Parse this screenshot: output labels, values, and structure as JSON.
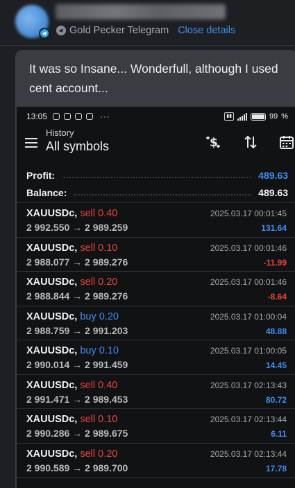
{
  "review": {
    "source": "Gold Pecker Telegram",
    "close_link": "Close details",
    "text": "It was so Insane... Wonderfull, although I used cent account..."
  },
  "phone": {
    "status": {
      "time": "13:05",
      "dots": "···",
      "battery": "99"
    },
    "app_bar": {
      "subtitle": "History",
      "title": "All symbols"
    },
    "summary": {
      "profit_label": "Profit:",
      "profit_value": "489.63",
      "balance_label": "Balance:",
      "balance_value": "489.63"
    },
    "trades": [
      {
        "symbol": "XAUUSDc,",
        "side": "sell",
        "side_text": "sell 0.40",
        "prices": "2 992.550 → 2 989.259",
        "date": "2025.03.17 00:01:45",
        "profit": "131.64",
        "sign": "pos"
      },
      {
        "symbol": "XAUUSDc,",
        "side": "sell",
        "side_text": "sell 0.10",
        "prices": "2 988.077 → 2 989.276",
        "date": "2025.03.17 00:01:46",
        "profit": "-11.99",
        "sign": "neg"
      },
      {
        "symbol": "XAUUSDc,",
        "side": "sell",
        "side_text": "sell 0.20",
        "prices": "2 988.844 → 2 989.276",
        "date": "2025.03.17 00:01:46",
        "profit": "-8.64",
        "sign": "neg"
      },
      {
        "symbol": "XAUUSDc,",
        "side": "buy",
        "side_text": "buy 0.20",
        "prices": "2 988.759 → 2 991.203",
        "date": "2025.03.17 01:00:04",
        "profit": "48.88",
        "sign": "pos"
      },
      {
        "symbol": "XAUUSDc,",
        "side": "buy",
        "side_text": "buy 0.10",
        "prices": "2 990.014 → 2 991.459",
        "date": "2025.03.17 01:00:05",
        "profit": "14.45",
        "sign": "pos"
      },
      {
        "symbol": "XAUUSDc,",
        "side": "sell",
        "side_text": "sell 0.40",
        "prices": "2 991.471 → 2 989.453",
        "date": "2025.03.17 02:13:43",
        "profit": "80.72",
        "sign": "pos"
      },
      {
        "symbol": "XAUUSDc,",
        "side": "sell",
        "side_text": "sell 0.10",
        "prices": "2 990.286 → 2 989.675",
        "date": "2025.03.17 02:13:44",
        "profit": "6.11",
        "sign": "pos"
      },
      {
        "symbol": "XAUUSDc,",
        "side": "sell",
        "side_text": "sell 0.20",
        "prices": "2 990.589 → 2 989.700",
        "date": "2025.03.17 02:13:44",
        "profit": "17.78",
        "sign": "pos"
      }
    ]
  },
  "colors": {
    "accent_blue": "#3f8ef2",
    "loss_red": "#e8453c",
    "link_blue": "#3d8ee8",
    "telegram_blue": "#2ea6e0"
  }
}
